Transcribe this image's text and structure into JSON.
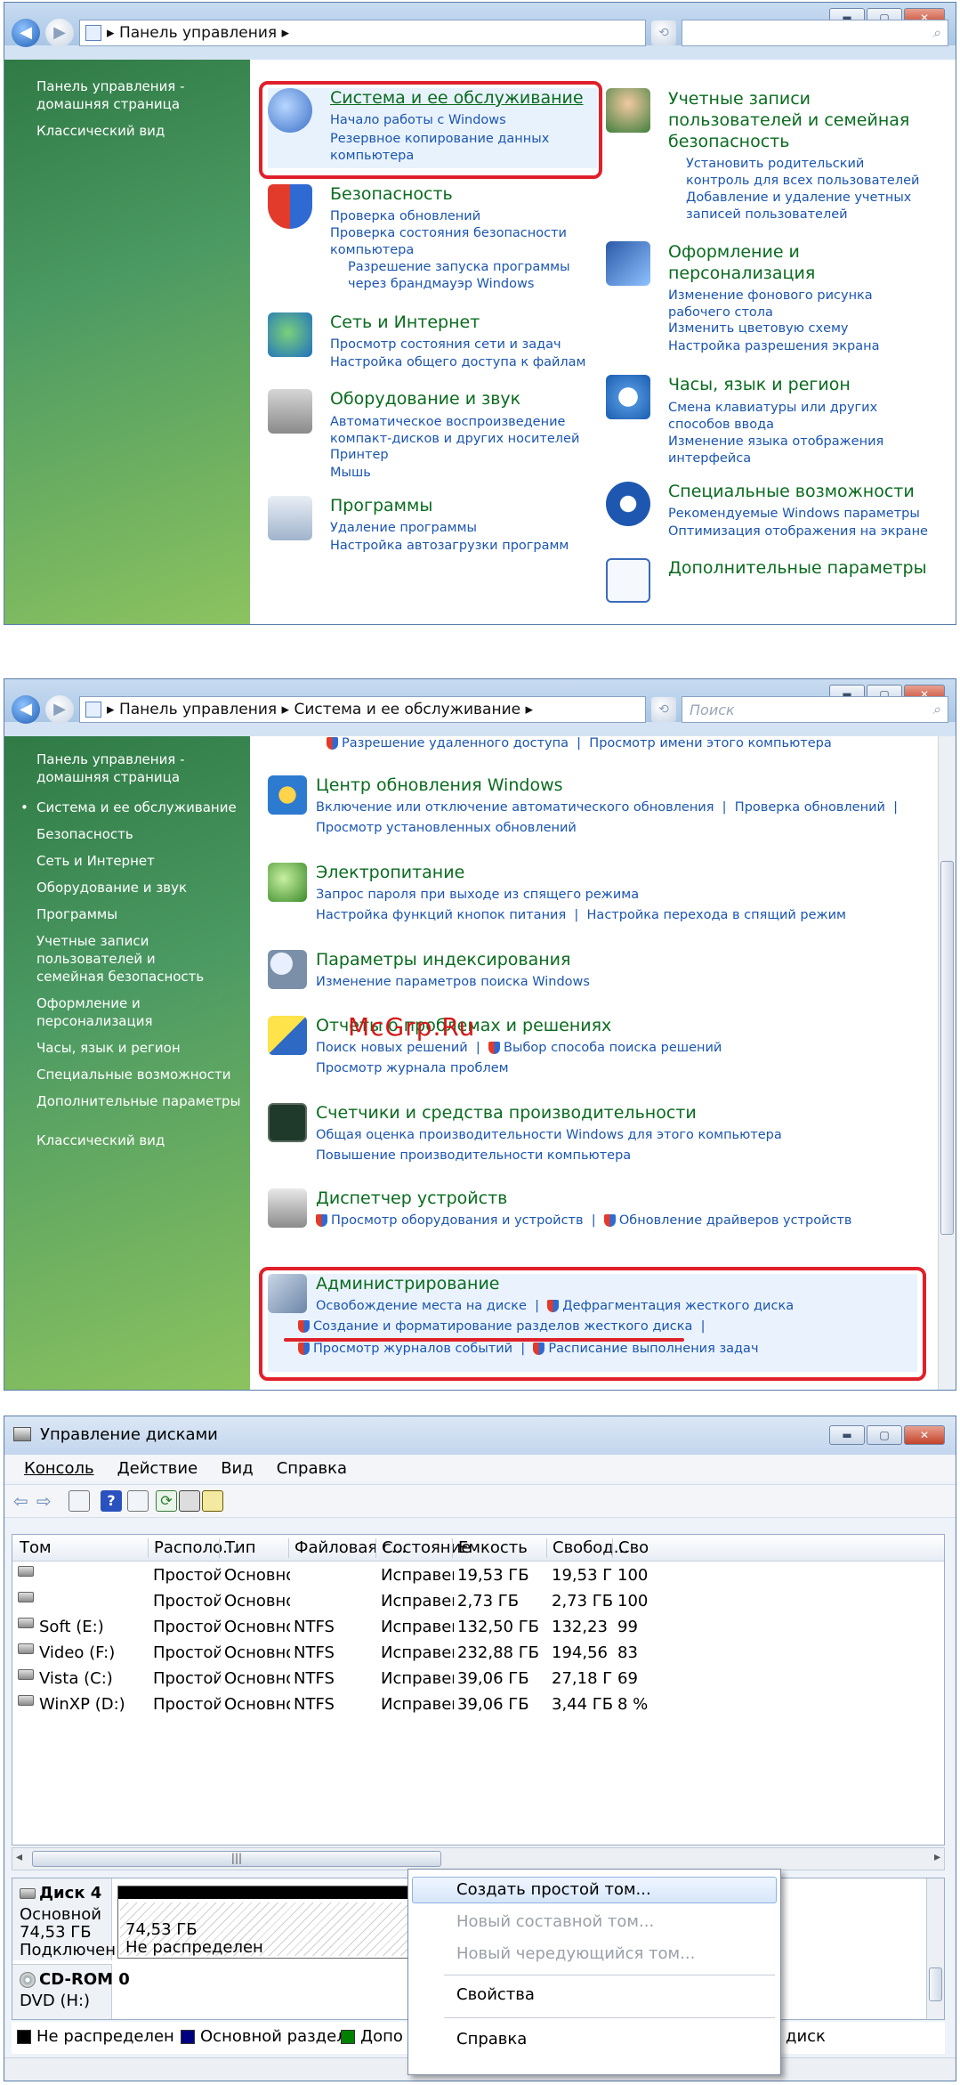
{
  "panel1": {
    "breadcrumb": "Панель управления",
    "sidebar": [
      "Панель управления - домашняя страница",
      "Классический вид"
    ],
    "categories": [
      {
        "title": "Система и ее обслуживание",
        "links": [
          "Начало работы с Windows",
          "Резервное копирование данных компьютера"
        ]
      },
      {
        "title": "Безопасность",
        "links": [
          "Проверка обновлений",
          "Проверка состояния безопасности компьютера",
          "Разрешение запуска программы через брандмауэр Windows"
        ]
      },
      {
        "title": "Сеть и Интернет",
        "links": [
          "Просмотр состояния сети и задач",
          "Настройка общего доступа к файлам"
        ]
      },
      {
        "title": "Оборудование и звук",
        "links": [
          "Автоматическое воспроизведение компакт-дисков и других носителей",
          "Принтер",
          "Мышь"
        ]
      },
      {
        "title": "Программы",
        "links": [
          "Удаление программы",
          "Настройка автозагрузки программ"
        ]
      },
      {
        "title": "Учетные записи пользователей и семейная безопасность",
        "links": [
          "Установить родительский контроль для всех пользователей",
          "Добавление и удаление учетных записей пользователей"
        ]
      },
      {
        "title": "Оформление и персонализация",
        "links": [
          "Изменение фонового рисунка рабочего стола",
          "Изменить цветовую схему",
          "Настройка разрешения экрана"
        ]
      },
      {
        "title": "Часы, язык и регион",
        "links": [
          "Смена клавиатуры или других способов ввода",
          "Изменение языка отображения интерфейса"
        ]
      },
      {
        "title": "Специальные возможности",
        "links": [
          "Рекомендуемые Windows параметры",
          "Оптимизация отображения на экране"
        ]
      },
      {
        "title": "Дополнительные параметры",
        "links": []
      }
    ]
  },
  "panel2": {
    "breadcrumb1": "Панель управления",
    "breadcrumb2": "Система и ее обслуживание",
    "search_placeholder": "Поиск",
    "sidebar": [
      "Панель управления - домашняя страница",
      "Система и ее обслуживание",
      "Безопасность",
      "Сеть и Интернет",
      "Оборудование и звук",
      "Программы",
      "Учетные записи пользователей и семейная безопасность",
      "Оформление и персонализация",
      "Часы, язык и регион",
      "Специальные возможности",
      "Дополнительные параметры",
      "Классический вид"
    ],
    "top_links": [
      "Разрешение удаленного доступа",
      "Просмотр имени этого компьютера"
    ],
    "sections": [
      {
        "title": "Центр обновления Windows",
        "links": [
          "Включение или отключение автоматического обновления",
          "Проверка обновлений",
          "Просмотр установленных обновлений"
        ]
      },
      {
        "title": "Электропитание",
        "links": [
          "Запрос пароля при выходе из спящего режима",
          "Настройка функций кнопок питания",
          "Настройка перехода в спящий режим"
        ]
      },
      {
        "title": "Параметры индексирования",
        "links": [
          "Изменение параметров поиска Windows"
        ]
      },
      {
        "title": "Отчеты о проблемах и решениях",
        "links": [
          "Поиск новых решений",
          "Выбор способа поиска решений",
          "Просмотр журнала проблем"
        ]
      },
      {
        "title": "Счетчики и средства производительности",
        "links": [
          "Общая оценка производительности Windows для этого компьютера",
          "Повышение производительности компьютера"
        ]
      },
      {
        "title": "Диспетчер устройств",
        "links": [
          "Просмотр оборудования и устройств",
          "Обновление драйверов устройств"
        ]
      },
      {
        "title": "Администрирование",
        "links": [
          "Освобождение места на диске",
          "Дефрагментация жесткого диска",
          "Создание и форматирование разделов жесткого диска",
          "Просмотр журналов событий",
          "Расписание выполнения задач"
        ]
      }
    ],
    "watermark": "McGrp.Ru"
  },
  "panel3": {
    "title": "Управление дисками",
    "menu": [
      "Консоль",
      "Действие",
      "Вид",
      "Справка"
    ],
    "columns": [
      "Том",
      "Располо...",
      "Тип",
      "Файловая с...",
      "Состояние",
      "Емкость",
      "Свобод...",
      "Сво"
    ],
    "rows": [
      [
        "",
        "Простой",
        "Основной",
        "",
        "Исправен...",
        "19,53 ГБ",
        "19,53 ГБ",
        "100"
      ],
      [
        "",
        "Простой",
        "Основной",
        "",
        "Исправен...",
        "2,73 ГБ",
        "2,73 ГБ",
        "100"
      ],
      [
        "Soft (E:)",
        "Простой",
        "Основной",
        "NTFS",
        "Исправен...",
        "132,50 ГБ",
        "132,23 ГБ",
        "99"
      ],
      [
        "Video (F:)",
        "Простой",
        "Основной",
        "NTFS",
        "Исправен...",
        "232,88 ГБ",
        "194,56 ГБ",
        "83"
      ],
      [
        "Vista (C:)",
        "Простой",
        "Основной",
        "NTFS",
        "Исправен...",
        "39,06 ГБ",
        "27,18 ГБ",
        "69"
      ],
      [
        "WinXP (D:)",
        "Простой",
        "Основной",
        "NTFS",
        "Исправен...",
        "39,06 ГБ",
        "3,44 ГБ",
        "8 %"
      ]
    ],
    "disk4": {
      "name": "Диск 4",
      "type": "Основной",
      "size": "74,53 ГБ",
      "state": "Подключен",
      "part_size": "74,53 ГБ",
      "part_state": "Не распределен"
    },
    "cdrom": {
      "name": "CD-ROM 0",
      "type": "DVD (H:)"
    },
    "legend": [
      "Не распределен",
      "Основной раздел",
      "Допо",
      "диск"
    ],
    "context_menu": [
      "Создать простой том...",
      "Новый составной том...",
      "Новый чередующийся том...",
      "Свойства",
      "Справка"
    ]
  }
}
